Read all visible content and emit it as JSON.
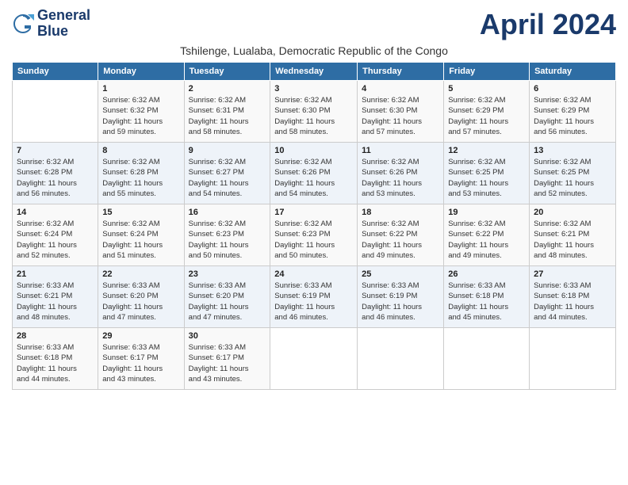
{
  "header": {
    "logo_line1": "General",
    "logo_line2": "Blue",
    "month_year": "April 2024",
    "location": "Tshilenge, Lualaba, Democratic Republic of the Congo"
  },
  "weekdays": [
    "Sunday",
    "Monday",
    "Tuesday",
    "Wednesday",
    "Thursday",
    "Friday",
    "Saturday"
  ],
  "weeks": [
    [
      {
        "day": "",
        "info": ""
      },
      {
        "day": "1",
        "info": "Sunrise: 6:32 AM\nSunset: 6:32 PM\nDaylight: 11 hours\nand 59 minutes."
      },
      {
        "day": "2",
        "info": "Sunrise: 6:32 AM\nSunset: 6:31 PM\nDaylight: 11 hours\nand 58 minutes."
      },
      {
        "day": "3",
        "info": "Sunrise: 6:32 AM\nSunset: 6:30 PM\nDaylight: 11 hours\nand 58 minutes."
      },
      {
        "day": "4",
        "info": "Sunrise: 6:32 AM\nSunset: 6:30 PM\nDaylight: 11 hours\nand 57 minutes."
      },
      {
        "day": "5",
        "info": "Sunrise: 6:32 AM\nSunset: 6:29 PM\nDaylight: 11 hours\nand 57 minutes."
      },
      {
        "day": "6",
        "info": "Sunrise: 6:32 AM\nSunset: 6:29 PM\nDaylight: 11 hours\nand 56 minutes."
      }
    ],
    [
      {
        "day": "7",
        "info": "Sunrise: 6:32 AM\nSunset: 6:28 PM\nDaylight: 11 hours\nand 56 minutes."
      },
      {
        "day": "8",
        "info": "Sunrise: 6:32 AM\nSunset: 6:28 PM\nDaylight: 11 hours\nand 55 minutes."
      },
      {
        "day": "9",
        "info": "Sunrise: 6:32 AM\nSunset: 6:27 PM\nDaylight: 11 hours\nand 54 minutes."
      },
      {
        "day": "10",
        "info": "Sunrise: 6:32 AM\nSunset: 6:26 PM\nDaylight: 11 hours\nand 54 minutes."
      },
      {
        "day": "11",
        "info": "Sunrise: 6:32 AM\nSunset: 6:26 PM\nDaylight: 11 hours\nand 53 minutes."
      },
      {
        "day": "12",
        "info": "Sunrise: 6:32 AM\nSunset: 6:25 PM\nDaylight: 11 hours\nand 53 minutes."
      },
      {
        "day": "13",
        "info": "Sunrise: 6:32 AM\nSunset: 6:25 PM\nDaylight: 11 hours\nand 52 minutes."
      }
    ],
    [
      {
        "day": "14",
        "info": "Sunrise: 6:32 AM\nSunset: 6:24 PM\nDaylight: 11 hours\nand 52 minutes."
      },
      {
        "day": "15",
        "info": "Sunrise: 6:32 AM\nSunset: 6:24 PM\nDaylight: 11 hours\nand 51 minutes."
      },
      {
        "day": "16",
        "info": "Sunrise: 6:32 AM\nSunset: 6:23 PM\nDaylight: 11 hours\nand 50 minutes."
      },
      {
        "day": "17",
        "info": "Sunrise: 6:32 AM\nSunset: 6:23 PM\nDaylight: 11 hours\nand 50 minutes."
      },
      {
        "day": "18",
        "info": "Sunrise: 6:32 AM\nSunset: 6:22 PM\nDaylight: 11 hours\nand 49 minutes."
      },
      {
        "day": "19",
        "info": "Sunrise: 6:32 AM\nSunset: 6:22 PM\nDaylight: 11 hours\nand 49 minutes."
      },
      {
        "day": "20",
        "info": "Sunrise: 6:32 AM\nSunset: 6:21 PM\nDaylight: 11 hours\nand 48 minutes."
      }
    ],
    [
      {
        "day": "21",
        "info": "Sunrise: 6:33 AM\nSunset: 6:21 PM\nDaylight: 11 hours\nand 48 minutes."
      },
      {
        "day": "22",
        "info": "Sunrise: 6:33 AM\nSunset: 6:20 PM\nDaylight: 11 hours\nand 47 minutes."
      },
      {
        "day": "23",
        "info": "Sunrise: 6:33 AM\nSunset: 6:20 PM\nDaylight: 11 hours\nand 47 minutes."
      },
      {
        "day": "24",
        "info": "Sunrise: 6:33 AM\nSunset: 6:19 PM\nDaylight: 11 hours\nand 46 minutes."
      },
      {
        "day": "25",
        "info": "Sunrise: 6:33 AM\nSunset: 6:19 PM\nDaylight: 11 hours\nand 46 minutes."
      },
      {
        "day": "26",
        "info": "Sunrise: 6:33 AM\nSunset: 6:18 PM\nDaylight: 11 hours\nand 45 minutes."
      },
      {
        "day": "27",
        "info": "Sunrise: 6:33 AM\nSunset: 6:18 PM\nDaylight: 11 hours\nand 44 minutes."
      }
    ],
    [
      {
        "day": "28",
        "info": "Sunrise: 6:33 AM\nSunset: 6:18 PM\nDaylight: 11 hours\nand 44 minutes."
      },
      {
        "day": "29",
        "info": "Sunrise: 6:33 AM\nSunset: 6:17 PM\nDaylight: 11 hours\nand 43 minutes."
      },
      {
        "day": "30",
        "info": "Sunrise: 6:33 AM\nSunset: 6:17 PM\nDaylight: 11 hours\nand 43 minutes."
      },
      {
        "day": "",
        "info": ""
      },
      {
        "day": "",
        "info": ""
      },
      {
        "day": "",
        "info": ""
      },
      {
        "day": "",
        "info": ""
      }
    ]
  ]
}
